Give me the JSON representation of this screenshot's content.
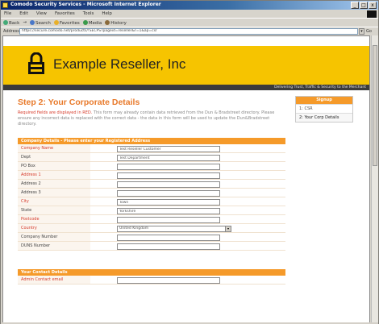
{
  "window": {
    "title": "Comodo Security Services - Microsoft Internet Explorer",
    "controls": [
      "_",
      "□",
      "x"
    ]
  },
  "menu": [
    "File",
    "Edit",
    "View",
    "Favorites",
    "Tools",
    "Help"
  ],
  "toolbar": {
    "back": "Back",
    "forward": "→",
    "search": "Search",
    "favorites": "Favorites",
    "media": "Media",
    "history": "History"
  },
  "address": {
    "label": "Address",
    "url": "https://secure.comodo.net/products/!SECPS?pageid=reseller&r=1&ap=csr",
    "go": "Go"
  },
  "site": {
    "company_name": "Example Reseller, Inc",
    "tagline": "Delivering Trust, Traffic & Security to the Merchant"
  },
  "page": {
    "step_title": "Step 2: Your Corporate Details",
    "intro_required": "Required fields are displayed in RED.",
    "intro_rest": "This form may already contain data retrieved from the Dun & Bradstreet directory. Please ensure any incorrect data is replaced with the correct data - the data in this form will be used to update the Dun&Bradstreet directory."
  },
  "signup_box": {
    "header": "Signup",
    "items": [
      {
        "label": "1: CSR"
      },
      {
        "label": "2: Your Corp Details"
      }
    ]
  },
  "company_section": {
    "header": "Company Details - Please enter your Registered Address",
    "rows": [
      {
        "label": "Company Name",
        "required": true,
        "value": "Test Reseller Customer"
      },
      {
        "label": "Dept",
        "required": false,
        "value": "Test Department"
      },
      {
        "label": "PO Box",
        "required": false,
        "value": ""
      },
      {
        "label": "Address 1",
        "required": true,
        "value": ""
      },
      {
        "label": "Address 2",
        "required": false,
        "value": ""
      },
      {
        "label": "Address 3",
        "required": false,
        "value": ""
      },
      {
        "label": "City",
        "required": true,
        "value": "Town"
      },
      {
        "label": "State",
        "required": false,
        "value": "Yorkshire"
      },
      {
        "label": "Postcode",
        "required": true,
        "value": ""
      },
      {
        "label": "Country",
        "required": true,
        "value": "United Kingdom",
        "type": "select"
      },
      {
        "label": "Company Number",
        "required": false,
        "value": ""
      },
      {
        "label": "DUNS Number",
        "required": false,
        "value": ""
      }
    ]
  },
  "contact_section": {
    "header": "Your Contact Details",
    "rows": [
      {
        "label": "Admin Contact email",
        "required": true,
        "value": ""
      }
    ]
  },
  "colors": {
    "banner": "#f6c400",
    "accent_orange": "#f59a2a",
    "required_red": "#d63a2a"
  }
}
